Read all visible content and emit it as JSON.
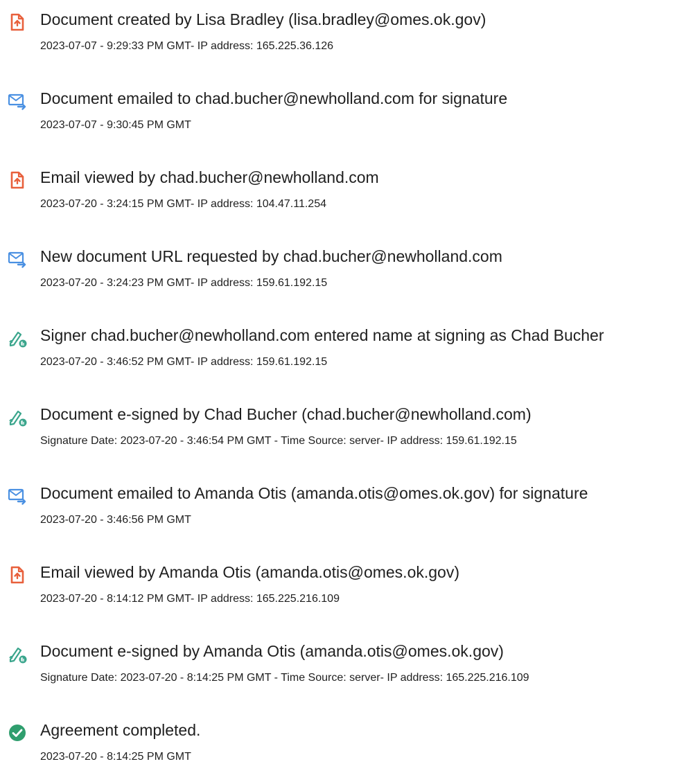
{
  "colors": {
    "document_icon": "#e8603c",
    "email_icon": "#4a90e2",
    "sign_icon": "#3aa58c",
    "complete_icon": "#2f9e6e",
    "text": "#1f1f1f"
  },
  "events": [
    {
      "icon": "document-icon",
      "title": "Document created by Lisa Bradley (lisa.bradley@omes.ok.gov)",
      "detail": "2023-07-07 - 9:29:33 PM GMT- IP address: 165.225.36.126"
    },
    {
      "icon": "email-icon",
      "title": "Document emailed to chad.bucher@newholland.com for signature",
      "detail": "2023-07-07 - 9:30:45 PM GMT"
    },
    {
      "icon": "document-icon",
      "title": "Email viewed by chad.bucher@newholland.com",
      "detail": "2023-07-20 - 3:24:15 PM GMT- IP address: 104.47.11.254"
    },
    {
      "icon": "email-icon",
      "title": "New document URL requested by chad.bucher@newholland.com",
      "detail": "2023-07-20 - 3:24:23 PM GMT- IP address: 159.61.192.15"
    },
    {
      "icon": "signature-icon",
      "title": "Signer chad.bucher@newholland.com entered name at signing as Chad Bucher",
      "detail": "2023-07-20 - 3:46:52 PM GMT- IP address: 159.61.192.15"
    },
    {
      "icon": "signature-icon",
      "title": "Document e-signed by Chad Bucher (chad.bucher@newholland.com)",
      "detail": "Signature Date: 2023-07-20 - 3:46:54 PM GMT - Time Source: server- IP address: 159.61.192.15"
    },
    {
      "icon": "email-icon",
      "title": "Document emailed to Amanda Otis (amanda.otis@omes.ok.gov) for signature",
      "detail": "2023-07-20 - 3:46:56 PM GMT"
    },
    {
      "icon": "document-icon",
      "title": "Email viewed by Amanda Otis (amanda.otis@omes.ok.gov)",
      "detail": "2023-07-20 - 8:14:12 PM GMT- IP address: 165.225.216.109"
    },
    {
      "icon": "signature-icon",
      "title": "Document e-signed by Amanda Otis (amanda.otis@omes.ok.gov)",
      "detail": "Signature Date: 2023-07-20 - 8:14:25 PM GMT - Time Source: server- IP address: 165.225.216.109"
    },
    {
      "icon": "checkmark-circle-icon",
      "title": "Agreement completed.",
      "detail": "2023-07-20 - 8:14:25 PM GMT"
    }
  ]
}
